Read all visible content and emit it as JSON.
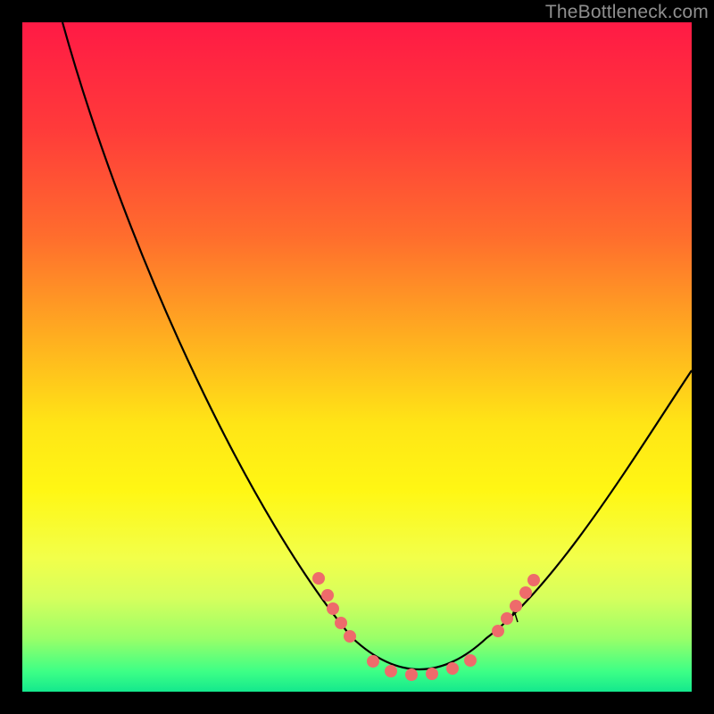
{
  "watermark": "TheBottleneck.com",
  "chart_data": {
    "type": "line",
    "title": "",
    "xlabel": "",
    "ylabel": "",
    "xlim": [
      0,
      100
    ],
    "ylim": [
      0,
      100
    ],
    "series": [
      {
        "name": "bottleneck-curve",
        "x": [
          6,
          15,
          25,
          35,
          42,
          49,
          55,
          59,
          65,
          69,
          75,
          83,
          92,
          100
        ],
        "y": [
          100,
          78,
          55,
          37,
          25,
          13,
          6,
          2,
          2,
          7,
          13,
          25,
          38,
          48
        ]
      },
      {
        "name": "markers",
        "x": [
          44,
          46,
          47,
          48,
          49,
          52,
          55,
          58,
          61,
          64,
          67,
          71,
          72,
          74,
          75,
          76
        ],
        "y": [
          17,
          15,
          13,
          11,
          9,
          5,
          3,
          3,
          3,
          4,
          5,
          9,
          11,
          13,
          15,
          17
        ]
      }
    ],
    "background_gradient": {
      "top": "#ff1a45",
      "mid": "#ffe516",
      "bottom": "#14e88d"
    },
    "marker_color": "#ee6b6b",
    "curve_color": "#000000"
  }
}
